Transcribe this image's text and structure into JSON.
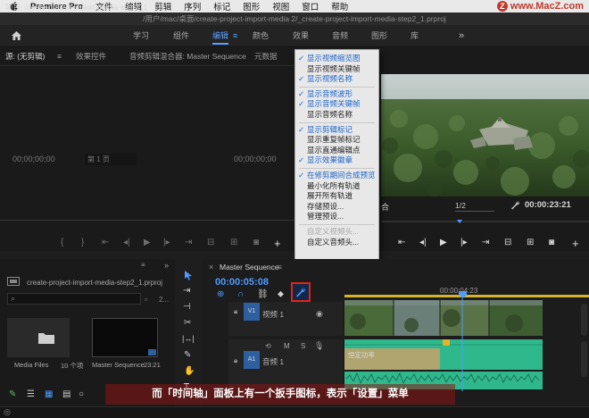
{
  "menubar": {
    "app_name": "Premiere Pro",
    "items": [
      "文件",
      "编辑",
      "剪辑",
      "序列",
      "标记",
      "图形",
      "视图",
      "窗口",
      "帮助"
    ],
    "watermark": "www.MacZ.com"
  },
  "window": {
    "title_path": "/用户/mac/桌面/create-project-import-media 2/_create-project-import-media-step2_1.prproj"
  },
  "workspaces": {
    "items": [
      "学习",
      "组件",
      "编辑",
      "颜色",
      "效果",
      "音频",
      "图形",
      "库"
    ],
    "active": "编辑",
    "more": "»"
  },
  "source_panel": {
    "tab_source": "源: (无剪辑)",
    "tab_menu": "≡",
    "tab_effects": "效果控件",
    "tab_mixer": "音频剪辑混合器: Master Sequence",
    "tab_meta": "元数据",
    "timecode_in": "00;00;00;00",
    "page": "第 1 页",
    "timecode_out": "00;00;00;00"
  },
  "program_panel": {
    "fit": "合",
    "resolution": "1/2",
    "timecode": "00:00:23:21"
  },
  "settings_menu": {
    "items": [
      {
        "label": "显示视频缩览图",
        "checked": true
      },
      {
        "label": "显示视频关键帧",
        "checked": false
      },
      {
        "label": "显示视频名称",
        "checked": true
      },
      {
        "sep": true
      },
      {
        "label": "显示音频波形",
        "checked": true
      },
      {
        "label": "显示音频关键帧",
        "checked": true
      },
      {
        "label": "显示音频名称",
        "checked": false
      },
      {
        "sep": true
      },
      {
        "label": "显示剪辑标记",
        "checked": true
      },
      {
        "label": "显示重复帧标记",
        "checked": false
      },
      {
        "label": "显示直通编辑点",
        "checked": false
      },
      {
        "label": "显示效果徽章",
        "checked": true
      },
      {
        "sep": true
      },
      {
        "label": "在修剪期间合成预览",
        "checked": true
      },
      {
        "label": "最小化所有轨道",
        "checked": false
      },
      {
        "label": "展开所有轨道",
        "checked": false
      },
      {
        "label": "存储预设...",
        "checked": false
      },
      {
        "label": "管理预设...",
        "checked": false
      },
      {
        "sep": true
      },
      {
        "label": "自定义视频头...",
        "checked": false,
        "disabled": true
      },
      {
        "label": "自定义音频头...",
        "checked": false
      }
    ]
  },
  "project_panel": {
    "title": "项目: create-project-import-media-step2_1",
    "file": "create-project-import-media-step2_1.prproj",
    "count": "2...",
    "bins": {
      "media_label": "Media Files",
      "media_count": "10 个项",
      "seq_label": "Master Sequence",
      "seq_duration": "23:21"
    }
  },
  "timeline": {
    "sequence_tab": "Master Sequence",
    "tab_menu": "≡",
    "timecode": "00:00:05:08",
    "ruler_tc": "00:00:04:23",
    "v1": "V1",
    "v1_name": "视频 1",
    "a1": "A1",
    "a1_name": "音频 1",
    "audio_clip_label": "恒定功率",
    "m": "M",
    "s": "S"
  },
  "caption": "而「时间轴」面板上有一个扳手图标，表示「设置」菜单",
  "colors": {
    "accent_blue": "#4f9bff",
    "highlight_red": "#e2231a",
    "audio_green": "#2fb88c",
    "menu_check": "#1a63c6"
  }
}
